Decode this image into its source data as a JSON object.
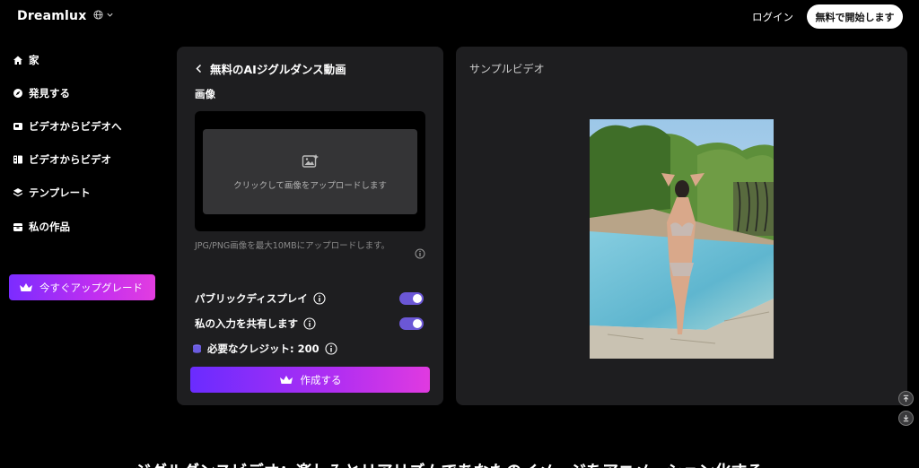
{
  "header": {
    "brand": "Dreamlux",
    "login_label": "ログイン",
    "start_free_label": "無料で開始します"
  },
  "sidebar": {
    "items": [
      {
        "label": "家",
        "icon": "home-icon"
      },
      {
        "label": "発見する",
        "icon": "compass-icon"
      },
      {
        "label": "ビデオからビデオへ",
        "icon": "video-icon"
      },
      {
        "label": "ビデオからビデオ",
        "icon": "film-icon"
      },
      {
        "label": "テンプレート",
        "icon": "layers-icon"
      },
      {
        "label": "私の作品",
        "icon": "box-icon"
      }
    ],
    "upgrade_label": "今すぐアップグレード"
  },
  "form": {
    "title": "無料のAIジグルダンス動画",
    "image_label": "画像",
    "upload_text": "クリックして画像をアップロードします",
    "hint": "JPG/PNG画像を最大10MBにアップロードします。",
    "public_display_label": "パブリックディスプレイ",
    "public_display_on": true,
    "share_input_label": "私の入力を共有します",
    "share_input_on": true,
    "credits_label": "必要なクレジット: 200",
    "create_label": "作成する"
  },
  "sample": {
    "title": "サンプルビデオ"
  },
  "bottom": {
    "heading": "ジグルダンスビデオ：楽しみとリアリズムであなたのイメージをアニメーション化する"
  },
  "colors": {
    "accent": "#6b57d6",
    "gradient_start": "#6a2cff",
    "gradient_end": "#e03ae0"
  }
}
